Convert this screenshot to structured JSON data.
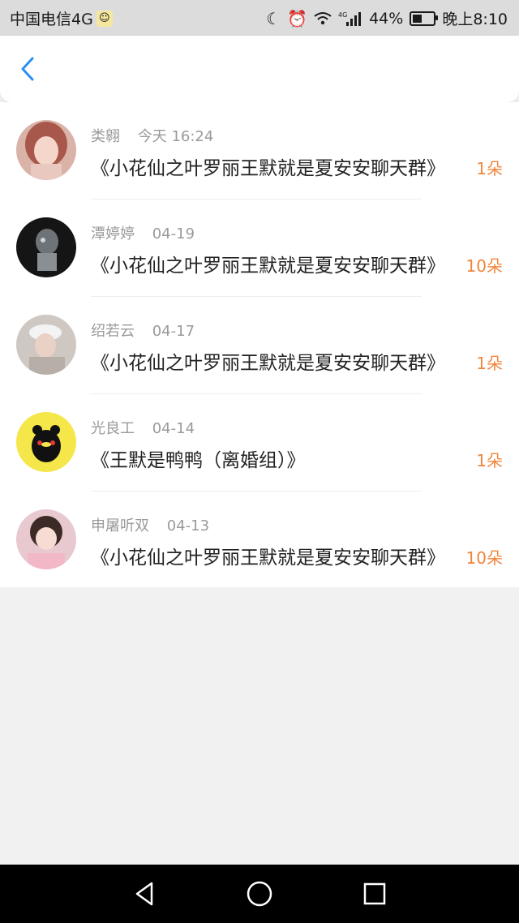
{
  "status_bar": {
    "carrier": "中国电信4G",
    "sim_icon": "sim-badge-icon",
    "network_label": "4G",
    "battery_percent": "44%",
    "battery_level": 0.44,
    "time": "晚上8:10"
  },
  "header": {
    "back_icon": "chevron-left-icon",
    "accent_color": "#2a8ff0"
  },
  "messages": [
    {
      "name": "类翱",
      "time": "今天 16:24",
      "title": "《小花仙之叶罗丽王默就是夏安安聊天群》",
      "count": "1朵"
    },
    {
      "name": "潭婷婷",
      "time": "04-19",
      "title": "《小花仙之叶罗丽王默就是夏安安聊天群》",
      "count": "10朵"
    },
    {
      "name": "绍若云",
      "time": "04-17",
      "title": "《小花仙之叶罗丽王默就是夏安安聊天群》",
      "count": "1朵"
    },
    {
      "name": "光良工",
      "time": "04-14",
      "title": "《王默是鸭鸭（离婚组）》",
      "count": "1朵"
    },
    {
      "name": "申屠听双",
      "time": "04-13",
      "title": "《小花仙之叶罗丽王默就是夏安安聊天群》",
      "count": "10朵"
    }
  ],
  "colors": {
    "count_orange": "#f1853b",
    "name_gray": "#9a9a9a",
    "background": "#f2f1f2"
  },
  "nav_bar": {
    "back_icon": "triangle-back-icon",
    "home_icon": "circle-home-icon",
    "recents_icon": "square-recents-icon"
  }
}
